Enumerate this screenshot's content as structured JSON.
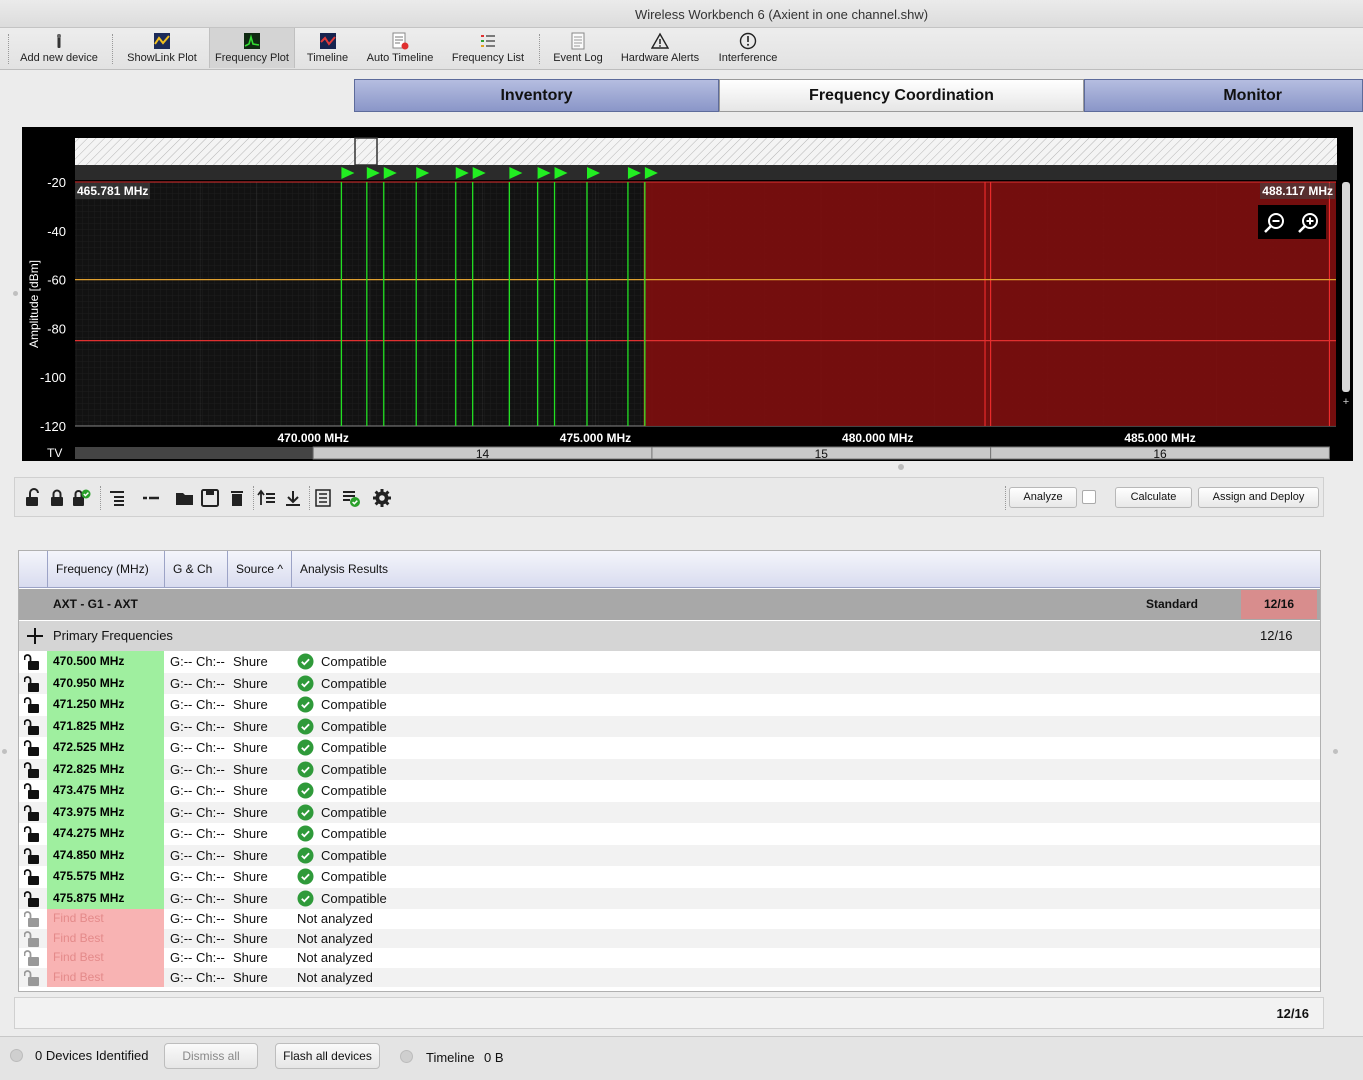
{
  "window": {
    "title": "Wireless Workbench 6 (Axient in one channel.shw)"
  },
  "toolbar": {
    "items": [
      {
        "label": "Add new device",
        "icon": "add-device-icon"
      },
      {
        "label": "ShowLink Plot",
        "icon": "showlink-plot-icon"
      },
      {
        "label": "Frequency Plot",
        "icon": "frequency-plot-icon"
      },
      {
        "label": "Timeline",
        "icon": "timeline-icon"
      },
      {
        "label": "Auto Timeline",
        "icon": "auto-timeline-icon"
      },
      {
        "label": "Frequency List",
        "icon": "frequency-list-icon"
      },
      {
        "label": "Event Log",
        "icon": "event-log-icon"
      },
      {
        "label": "Hardware Alerts",
        "icon": "hardware-alerts-icon"
      },
      {
        "label": "Interference",
        "icon": "interference-icon"
      }
    ],
    "active": "Frequency Plot"
  },
  "tabs": [
    {
      "label": "Inventory"
    },
    {
      "label": "Frequency Coordination"
    },
    {
      "label": "Monitor"
    }
  ],
  "plot": {
    "ylabel": "Amplitude [dBm]",
    "y_ticks": [
      "-20",
      "-40",
      "-60",
      "-80",
      "-100",
      "-120"
    ],
    "x_ticks": [
      "470.000 MHz",
      "475.000 MHz",
      "480.000 MHz",
      "485.000 MHz"
    ],
    "range_start": "465.781 MHz",
    "range_end": "488.117 MHz",
    "tv_label": "TV",
    "tv_channels": [
      "14",
      "15",
      "16"
    ],
    "colors": {
      "exclusion": "#7a0f0f",
      "carrier": "#22e022",
      "threshold": "#e03030"
    }
  },
  "chart_data": {
    "type": "line",
    "xlabel": "",
    "ylabel": "Amplitude [dBm]",
    "xlim": [
      465.781,
      488.117
    ],
    "ylim": [
      -120,
      -20
    ],
    "carriers_mhz": [
      470.5,
      470.95,
      471.25,
      471.825,
      472.525,
      472.825,
      473.475,
      473.975,
      474.275,
      474.85,
      475.575,
      475.875
    ],
    "excluded_range_mhz": [
      475.9,
      488.117
    ]
  },
  "coordbar": {
    "analyze": "Analyze",
    "calculate": "Calculate",
    "assign": "Assign and Deploy"
  },
  "table": {
    "headers": [
      "Frequency (MHz)",
      "G & Ch",
      "Source",
      "Analysis Results"
    ],
    "sort_indicator": "^",
    "group": {
      "name": "AXT - G1 - AXT",
      "standard": "Standard",
      "count": "12/16"
    },
    "primary": {
      "label": "Primary Frequencies",
      "count": "12/16"
    },
    "rows": [
      {
        "freq": "470.500 MHz",
        "gch": "G:-- Ch:--",
        "source": "Shure",
        "result": "Compatible"
      },
      {
        "freq": "470.950 MHz",
        "gch": "G:-- Ch:--",
        "source": "Shure",
        "result": "Compatible"
      },
      {
        "freq": "471.250 MHz",
        "gch": "G:-- Ch:--",
        "source": "Shure",
        "result": "Compatible"
      },
      {
        "freq": "471.825 MHz",
        "gch": "G:-- Ch:--",
        "source": "Shure",
        "result": "Compatible"
      },
      {
        "freq": "472.525 MHz",
        "gch": "G:-- Ch:--",
        "source": "Shure",
        "result": "Compatible"
      },
      {
        "freq": "472.825 MHz",
        "gch": "G:-- Ch:--",
        "source": "Shure",
        "result": "Compatible"
      },
      {
        "freq": "473.475 MHz",
        "gch": "G:-- Ch:--",
        "source": "Shure",
        "result": "Compatible"
      },
      {
        "freq": "473.975 MHz",
        "gch": "G:-- Ch:--",
        "source": "Shure",
        "result": "Compatible"
      },
      {
        "freq": "474.275 MHz",
        "gch": "G:-- Ch:--",
        "source": "Shure",
        "result": "Compatible"
      },
      {
        "freq": "474.850 MHz",
        "gch": "G:-- Ch:--",
        "source": "Shure",
        "result": "Compatible"
      },
      {
        "freq": "475.575 MHz",
        "gch": "G:-- Ch:--",
        "source": "Shure",
        "result": "Compatible"
      },
      {
        "freq": "475.875 MHz",
        "gch": "G:-- Ch:--",
        "source": "Shure",
        "result": "Compatible"
      },
      {
        "freq": "Find Best",
        "gch": "G:-- Ch:--",
        "source": "Shure",
        "result": "Not analyzed"
      },
      {
        "freq": "Find Best",
        "gch": "G:-- Ch:--",
        "source": "Shure",
        "result": "Not analyzed"
      },
      {
        "freq": "Find Best",
        "gch": "G:-- Ch:--",
        "source": "Shure",
        "result": "Not analyzed"
      },
      {
        "freq": "Find Best",
        "gch": "G:-- Ch:--",
        "source": "Shure",
        "result": "Not analyzed"
      }
    ],
    "summary_count": "12/16"
  },
  "statusbar": {
    "devices": "0 Devices Identified",
    "dismiss": "Dismiss all",
    "flash": "Flash all devices",
    "timeline": "Timeline",
    "timeline_size": "0 B"
  }
}
